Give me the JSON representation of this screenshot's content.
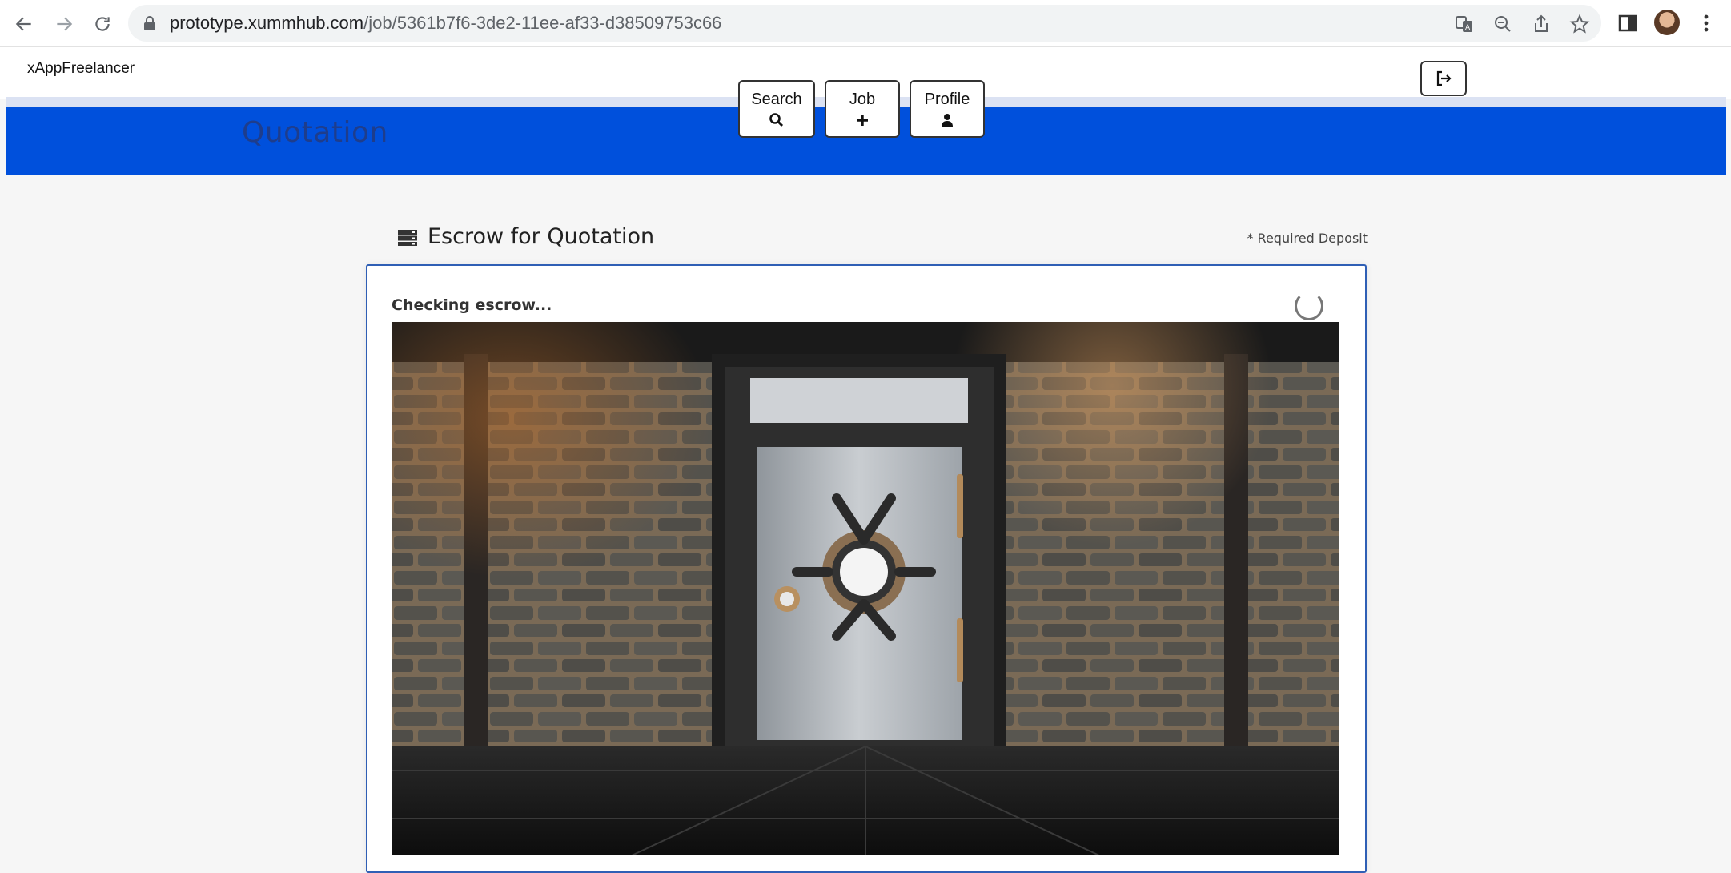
{
  "browser": {
    "url_host": "prototype.xummhub.com",
    "url_path": "/job/5361b7f6-3de2-11ee-af33-d38509753c66"
  },
  "app": {
    "brand": "xAppFreelancer",
    "page_title": "Quotation"
  },
  "nav": {
    "search_label": "Search",
    "job_label": "Job",
    "profile_label": "Profile"
  },
  "icons": {
    "search": "search-icon",
    "job": "plus-icon",
    "profile": "user-icon",
    "logout": "sign-out-icon",
    "section": "server-icon"
  },
  "section": {
    "title": "Escrow for Quotation",
    "required_note": "* Required Deposit"
  },
  "escrow": {
    "status_text": "Checking escrow..."
  },
  "colors": {
    "hero_bg": "#0050dc",
    "hero_title": "#1e3d8c",
    "card_border": "#2f5fb5"
  }
}
